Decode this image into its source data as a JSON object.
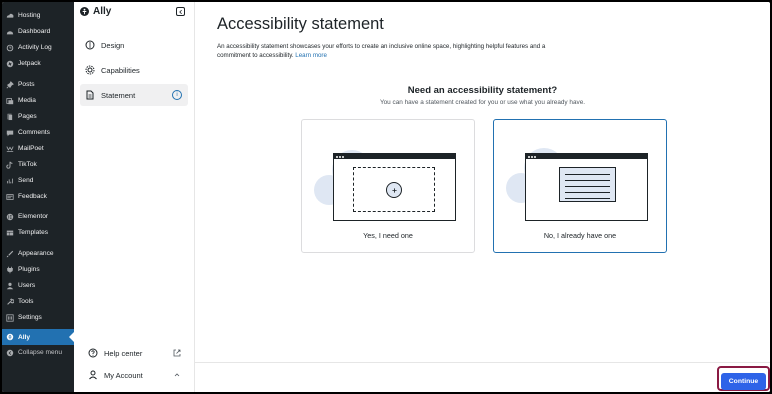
{
  "wp_menu": [
    {
      "label": "Hosting",
      "icon": "hosting-icon"
    },
    {
      "label": "Dashboard",
      "icon": "dashboard-icon"
    },
    {
      "label": "Activity Log",
      "icon": "activity-log-icon"
    },
    {
      "label": "Jetpack",
      "icon": "jetpack-icon"
    },
    {
      "label": "Posts",
      "icon": "pin-icon"
    },
    {
      "label": "Media",
      "icon": "media-icon"
    },
    {
      "label": "Pages",
      "icon": "pages-icon"
    },
    {
      "label": "Comments",
      "icon": "comments-icon"
    },
    {
      "label": "MailPoet",
      "icon": "mailpoet-icon"
    },
    {
      "label": "TikTok",
      "icon": "tiktok-icon"
    },
    {
      "label": "Send",
      "icon": "send-icon"
    },
    {
      "label": "Feedback",
      "icon": "feedback-icon"
    },
    {
      "label": "Elementor",
      "icon": "elementor-icon"
    },
    {
      "label": "Templates",
      "icon": "templates-icon"
    },
    {
      "label": "Appearance",
      "icon": "appearance-icon"
    },
    {
      "label": "Plugins",
      "icon": "plugins-icon"
    },
    {
      "label": "Users",
      "icon": "users-icon"
    },
    {
      "label": "Tools",
      "icon": "tools-icon"
    },
    {
      "label": "Settings",
      "icon": "settings-icon"
    },
    {
      "label": "Ally",
      "icon": "ally-icon",
      "active": true
    },
    {
      "label": "Collapse menu",
      "icon": "collapse-icon"
    }
  ],
  "ally_nav": {
    "brand": "Ally",
    "items": [
      {
        "label": "Design",
        "icon": "design-icon"
      },
      {
        "label": "Capabilities",
        "icon": "capabilities-icon"
      },
      {
        "label": "Statement",
        "icon": "statement-icon",
        "active": true
      }
    ],
    "footer": [
      {
        "label": "Help center",
        "icon": "help-icon",
        "trail": "external-link-icon"
      },
      {
        "label": "My Account",
        "icon": "user-icon",
        "trail": "chevron-up-icon"
      }
    ]
  },
  "main": {
    "title": "Accessibility statement",
    "description": "An accessibility statement showcases your efforts to create an inclusive online space, highlighting helpful features and a commitment to accessibility.",
    "learn_more": "Learn more",
    "question": "Need an accessibility statement?",
    "subquestion": "You can have a statement created for you or use what you already have.",
    "options": [
      {
        "label": "Yes, I need one",
        "selected": false
      },
      {
        "label": "No, I already have one",
        "selected": true
      }
    ],
    "continue_label": "Continue"
  },
  "colors": {
    "wp_sidebar": "#1d2327",
    "wp_active": "#2271b1",
    "primary_button": "#2e63e8",
    "selected_border": "#2271b1",
    "highlight_outline": "#8a1a43"
  }
}
